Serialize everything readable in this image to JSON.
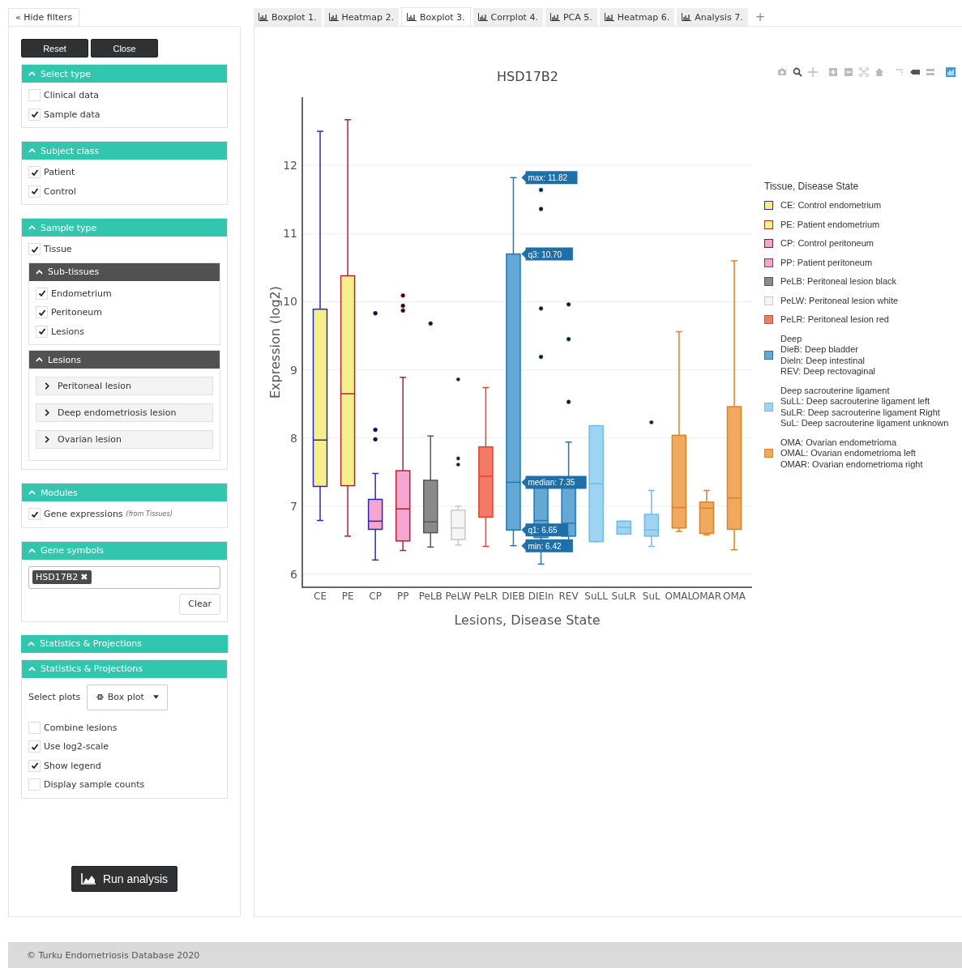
{
  "hide_filters": {
    "icon": "«",
    "label": "Hide filters"
  },
  "filter_buttons": [
    "Reset",
    "Close"
  ],
  "panels": [
    {
      "title": "Select type",
      "expanded": true,
      "items": [
        {
          "kind": "checkbox",
          "label": "Clinical data",
          "checked": false
        },
        {
          "kind": "checkbox",
          "label": "Sample data",
          "checked": true
        }
      ]
    },
    {
      "title": "Subject class",
      "expanded": true,
      "items": [
        {
          "kind": "checkbox",
          "label": "Patient",
          "checked": true
        },
        {
          "kind": "checkbox",
          "label": "Control",
          "checked": true
        }
      ]
    },
    {
      "title": "Sample type",
      "expanded": true,
      "items": [
        {
          "kind": "checkbox",
          "label": "Tissue",
          "checked": true
        },
        {
          "kind": "subpanel",
          "title": "Sub-tissues",
          "expanded": true,
          "items": [
            {
              "kind": "checkbox",
              "label": "Endometrium",
              "checked": true
            },
            {
              "kind": "checkbox",
              "label": "Peritoneum",
              "checked": true
            },
            {
              "kind": "checkbox",
              "label": "Lesions",
              "checked": true
            }
          ]
        },
        {
          "kind": "subpanel",
          "title": "Lesions",
          "expanded": true,
          "items": [
            {
              "kind": "collapsible",
              "label": "Peritoneal lesion",
              "expanded": false
            },
            {
              "kind": "collapsible",
              "label": "Deep endometriosis lesion",
              "expanded": false
            },
            {
              "kind": "collapsible",
              "label": "Ovarian lesion",
              "expanded": false
            }
          ]
        }
      ]
    },
    {
      "title": "Modules",
      "expanded": true,
      "items": [
        {
          "kind": "checkbox",
          "label": "Gene expressions",
          "note": "(from Tissues)",
          "checked": true
        }
      ]
    },
    {
      "title": "Gene symbols",
      "expanded": true,
      "items": [
        {
          "kind": "tags",
          "tags": [
            {
              "label": "HSD17B2",
              "remove": "✖"
            }
          ]
        },
        {
          "kind": "button",
          "label": "Clear"
        }
      ]
    },
    {
      "title": "Statistics & Projections",
      "expanded": true
    },
    {
      "title": "Statistics & Projections",
      "expanded": true,
      "items": [
        {
          "kind": "select",
          "label": "Select plots",
          "value": "Box plot"
        },
        {
          "kind": "checkbox",
          "label": "Combine lesions",
          "checked": false
        },
        {
          "kind": "checkbox",
          "label": "Use log2-scale",
          "checked": true
        },
        {
          "kind": "checkbox",
          "label": "Show legend",
          "checked": true
        },
        {
          "kind": "checkbox",
          "label": "Display sample counts",
          "checked": false
        }
      ]
    }
  ],
  "run_button": "Run analysis",
  "tabs": [
    {
      "label": "Boxplot 1.",
      "selected": false
    },
    {
      "label": "Heatmap 2.",
      "selected": false
    },
    {
      "label": "Boxplot 3.",
      "selected": true
    },
    {
      "label": "Corrplot 4.",
      "selected": false
    },
    {
      "label": "PCA 5.",
      "selected": false
    },
    {
      "label": "Heatmap 6.",
      "selected": false
    },
    {
      "label": "Analysis 7.",
      "selected": false
    }
  ],
  "add_tab": "+",
  "chart_data": {
    "type": "box",
    "title": "HSD17B2",
    "xlabel": "Lesions, Disease State",
    "ylabel": "Expression (log2)",
    "ylim": [
      5.81,
      13.0
    ],
    "yticks": [
      6,
      7,
      8,
      9,
      10,
      11,
      12
    ],
    "categories": [
      "CE",
      "PE",
      "CP",
      "PP",
      "PeLB",
      "PeLW",
      "PeLR",
      "DIEB",
      "DIEIn",
      "REV",
      "SuLL",
      "SuLR",
      "SuL",
      "OMAL",
      "OMAR",
      "OMA"
    ],
    "grid": true,
    "annotations": [
      "max: 11.82",
      "q3: 10.70",
      "median: 7.35",
      "q1: 6.65",
      "min: 6.42"
    ]
  },
  "legend": {
    "title": "Tissue, Disease State",
    "items": [
      {
        "lines": [
          "CE: Control endometrium"
        ],
        "color": "#f5ef8a"
      },
      {
        "lines": [
          "PE: Patient endometrium"
        ],
        "color": "#f5ef8a"
      },
      {
        "lines": [
          "CP: Control peritoneum"
        ],
        "color": "#f4a6d0"
      },
      {
        "lines": [
          "PP: Patient peritoneum"
        ],
        "color": "#f4a6d0"
      },
      {
        "lines": [
          "PeLB: Peritoneal lesion black"
        ],
        "color": "#8a8a8a"
      },
      {
        "lines": [
          "PeLW: Peritoneal lesion white"
        ],
        "color": "#f7f4f4"
      },
      {
        "lines": [
          "PeLR: Peritoneal lesion red"
        ],
        "color": "#f27a66"
      },
      {
        "lines": [
          "Deep",
          "DieB: Deep bladder",
          "Dieln: Deep intestinal",
          "REV: Deep rectovaginal"
        ],
        "color": "#64a8d6"
      },
      {
        "lines": [
          "Deep sacrouterine ligament",
          "SuLL: Deep sacrouterine ligament left",
          "SuLR: Deep sacrouterine ligament Right",
          "SuL: Deep sacrouterine ligament unknown"
        ],
        "color": "#9fd3f2"
      },
      {
        "lines": [
          "OMA: Ovarian endometrioma",
          "OMAL: Ovarian endometrioma left",
          "OMAR: Ovarian endometrioma right"
        ],
        "color": "#efaa60"
      }
    ]
  },
  "footer": "© Turku Endometriosis Database 2020"
}
